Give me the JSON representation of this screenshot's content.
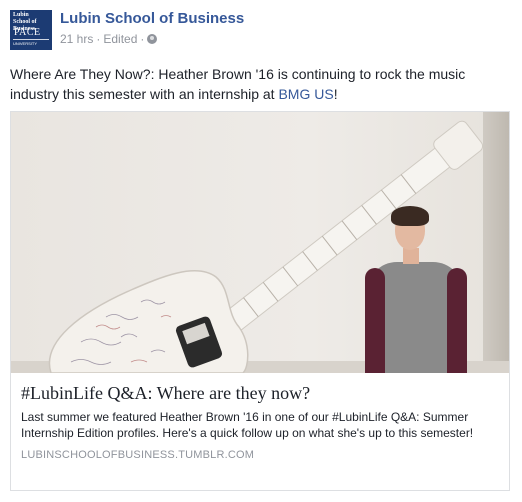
{
  "page": {
    "name": "Lubin School of Business",
    "timestamp": "21 hrs",
    "edited": "Edited",
    "separator": "·",
    "privacy_icon": "globe-icon"
  },
  "avatar": {
    "top_text": "Lubin\nSchool of Business",
    "logo_text": "PACE",
    "sub_text": "UNIVERSITY"
  },
  "post": {
    "text_before": "Where Are They Now?: Heather Brown '16 is continuing to rock the music industry this semester with an internship at ",
    "link_text": "BMG US",
    "text_after": "!"
  },
  "card": {
    "title": "#LubinLife Q&A: Where are they now?",
    "description": "Last summer we featured Heather Brown '16 in one of our #LubinLife Q&A: Summer Internship Edition profiles. Here's a quick follow up on what she's up to this semester!",
    "domain": "LUBINSCHOOLOFBUSINESS.TUMBLR.COM"
  },
  "colors": {
    "link": "#365899",
    "meta": "#90949c",
    "avatar_bg": "#1c3b73"
  }
}
